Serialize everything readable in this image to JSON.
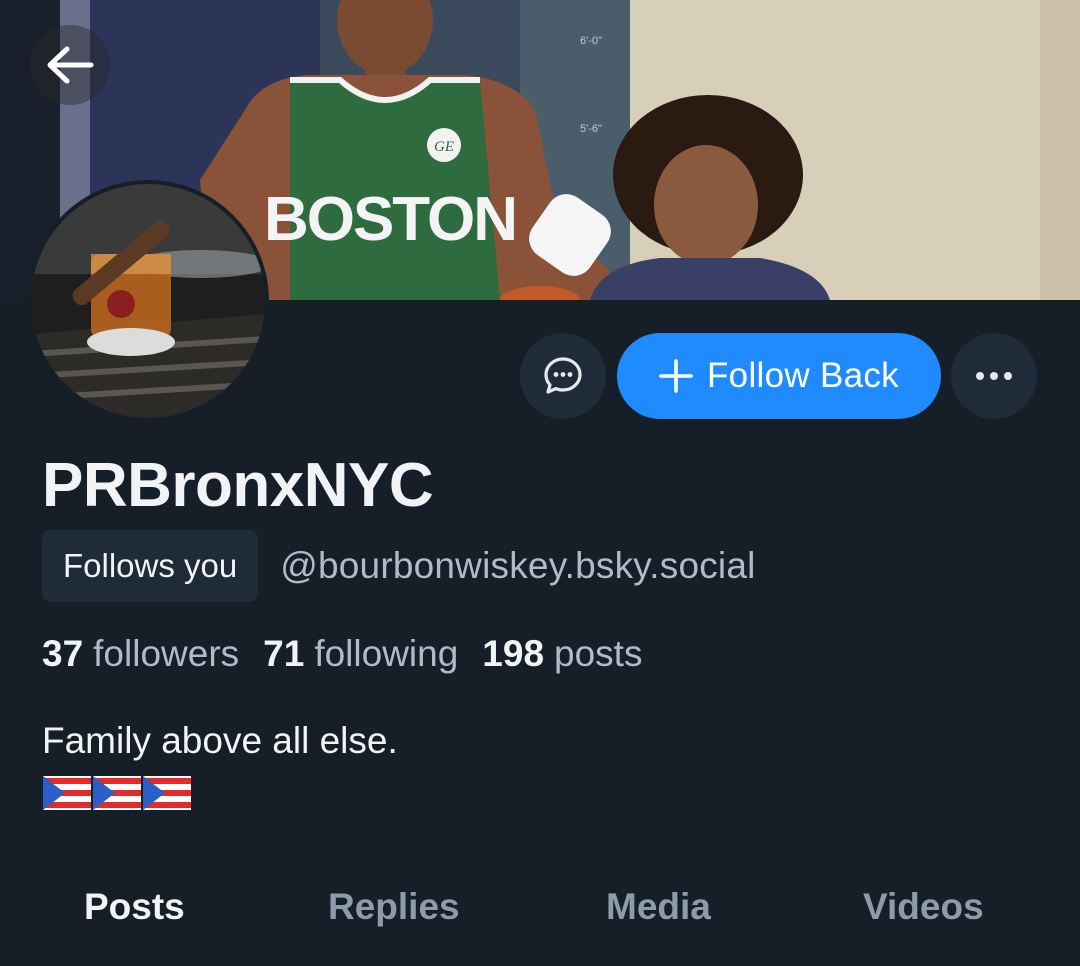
{
  "header": {
    "back_icon": "arrow-left-icon"
  },
  "profile": {
    "display_name": "PRBronxNYC",
    "follows_you_badge": "Follows you",
    "handle": "@bourbonwiskey.bsky.social",
    "bio": "Family above all else.",
    "bio_flags": [
      "🇵🇷",
      "🇵🇷",
      "🇵🇷"
    ],
    "banner_jersey_text": "BOSTON"
  },
  "stats": {
    "followers_count": "37",
    "followers_label": "followers",
    "following_count": "71",
    "following_label": "following",
    "posts_count": "198",
    "posts_label": "posts"
  },
  "actions": {
    "message_icon": "chat-bubble-icon",
    "follow_back_icon": "plus-icon",
    "follow_back_label": "Follow Back",
    "more_icon": "ellipsis-icon"
  },
  "tabs": [
    {
      "label": "Posts",
      "active": true
    },
    {
      "label": "Replies",
      "active": false
    },
    {
      "label": "Media",
      "active": false
    },
    {
      "label": "Videos",
      "active": false
    }
  ],
  "colors": {
    "background": "#161e27",
    "accent": "#208bfe",
    "secondary_button": "#1f2b38",
    "muted_text": "#aebbc9"
  }
}
